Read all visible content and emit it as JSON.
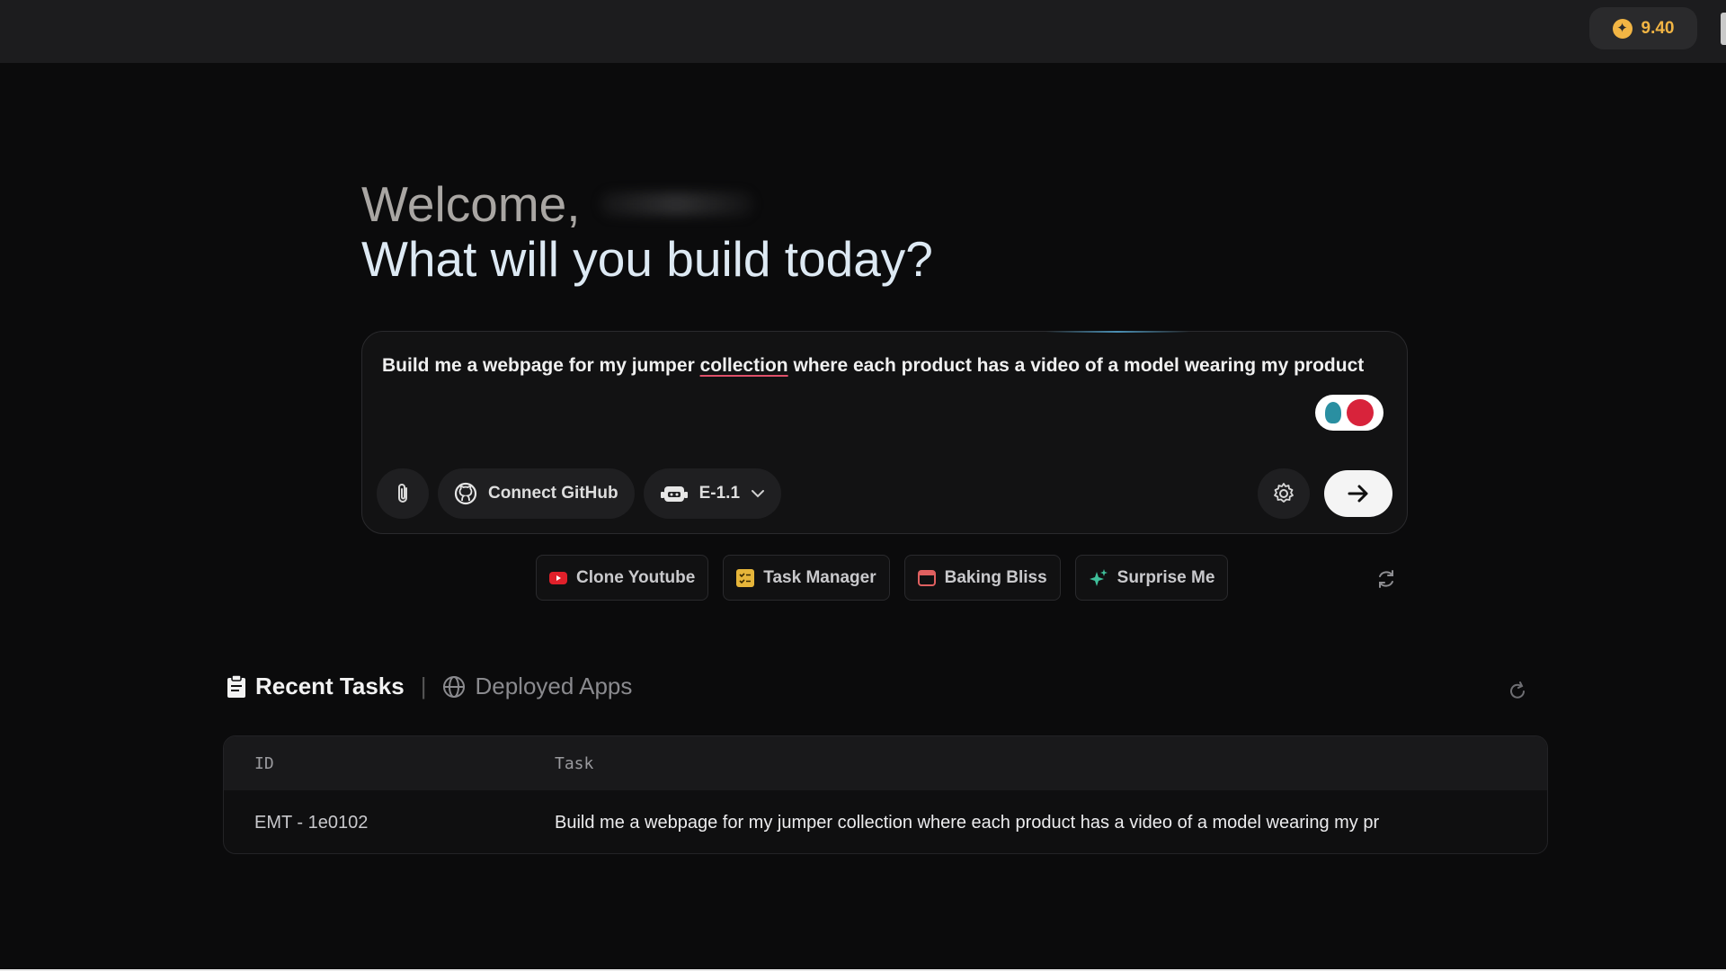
{
  "topbar": {
    "credits": "9.40",
    "credits_icon": "coin-icon"
  },
  "hero": {
    "welcome": "Welcome,",
    "question": "What will you build today?"
  },
  "prompt": {
    "text_before": "Build me a webpage for my jumper ",
    "text_misspelled": "collection",
    "text_after": " where each product has a video of a model wearing my product",
    "attach_icon": "paperclip-icon",
    "github_label": "Connect GitHub",
    "model_label": "E-1.1",
    "settings_icon": "gear-icon",
    "send_icon": "arrow-right-icon"
  },
  "suggestions": [
    {
      "label": "Clone Youtube",
      "icon": "youtube-icon",
      "color": "#e0202a"
    },
    {
      "label": "Task Manager",
      "icon": "checklist-icon",
      "color": "#e6b53a"
    },
    {
      "label": "Baking Bliss",
      "icon": "window-icon",
      "color": "#e06060"
    },
    {
      "label": "Surprise Me",
      "icon": "sparkle-icon",
      "color": "#3fbf9a"
    }
  ],
  "tabs": {
    "recent": "Recent Tasks",
    "separator": "|",
    "deployed": "Deployed Apps"
  },
  "table": {
    "headers": {
      "id": "ID",
      "task": "Task"
    },
    "rows": [
      {
        "id": "EMT - 1e0102",
        "task": "Build me a webpage for my jumper collection where each product has a video of a model wearing my pr"
      }
    ]
  }
}
